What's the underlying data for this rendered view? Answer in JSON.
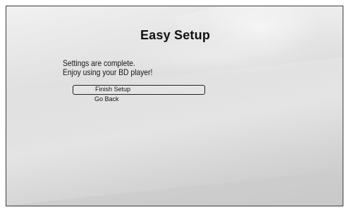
{
  "dialog": {
    "title": "Easy Setup",
    "message_lines": [
      "Settings are complete.",
      "Enjoy using your BD player!"
    ]
  },
  "menu": {
    "items": [
      {
        "label": "Finish Setup",
        "selected": true
      },
      {
        "label": "Go Back",
        "selected": false
      }
    ]
  }
}
